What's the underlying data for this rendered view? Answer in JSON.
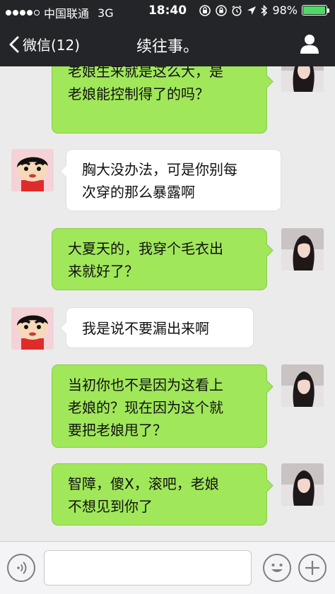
{
  "status_bar": {
    "carrier": "中国联通",
    "network": "3G",
    "time": "18:40",
    "battery_percent": "98%",
    "battery_level": 0.98,
    "signal_bars_filled": 4,
    "icons": [
      "rotation-lock-icon",
      "lock-icon",
      "alarm-icon",
      "location-arrow-icon",
      "bluetooth-icon",
      "battery-icon"
    ]
  },
  "nav": {
    "back_label": "微信(12)",
    "title": "续往事。",
    "icons": [
      "chevron-left-icon",
      "profile-icon"
    ]
  },
  "messages": [
    {
      "from": "me",
      "lines": [
        "老娘生来就是这么大，是",
        "老娘能控制得了的吗？"
      ]
    },
    {
      "from": "friend",
      "lines": [
        "胸大没办法，可是你别每",
        "次穿的那么暴露啊"
      ]
    },
    {
      "from": "me",
      "lines": [
        "大夏天的，我穿个毛衣出",
        "来就好了？"
      ]
    },
    {
      "from": "friend",
      "lines": [
        "我是说不要漏出来啊"
      ]
    },
    {
      "from": "me",
      "lines": [
        "当初你也不是因为这看上",
        "老娘的？现在因为这个就",
        "要把老娘甩了？"
      ]
    },
    {
      "from": "me",
      "lines": [
        "智障，傻X，滚吧，老娘",
        "不想见到你了"
      ]
    }
  ],
  "input_bar": {
    "text_value": "",
    "icons": [
      "voice-icon",
      "emoji-icon",
      "plus-icon"
    ]
  },
  "colors": {
    "bar_background": "#242528",
    "chat_background": "#ebebeb",
    "outgoing_bubble": "#a0e75a",
    "incoming_bubble": "#ffffff",
    "battery_fill": "#4cd964"
  }
}
